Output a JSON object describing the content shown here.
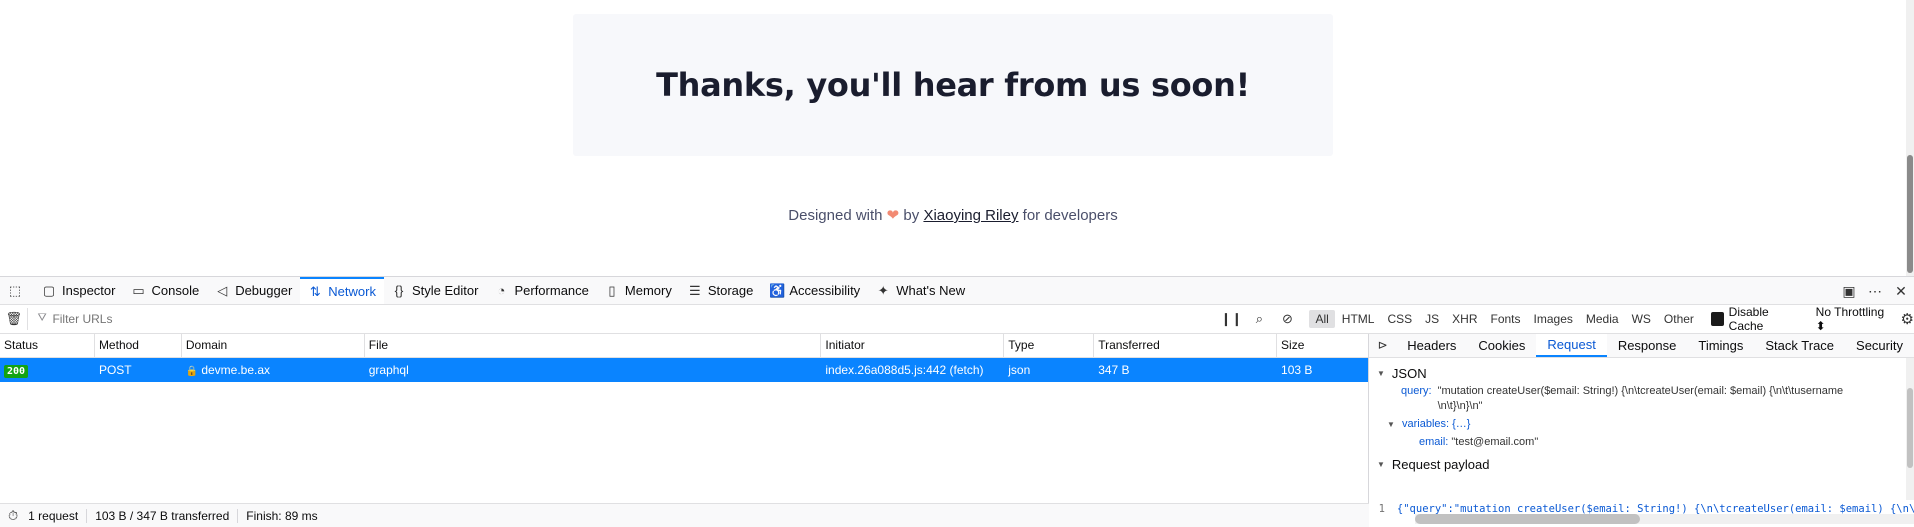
{
  "page": {
    "thanks_title": "Thanks, you'll hear from us soon!",
    "footer": {
      "prefix": "Designed with",
      "heart": "❤",
      "by": "by",
      "author": "Xiaoying Riley",
      "suffix": "for developers"
    }
  },
  "devtools": {
    "tabs": [
      {
        "label": "Inspector",
        "icon": "inspector-icon"
      },
      {
        "label": "Console",
        "icon": "console-icon"
      },
      {
        "label": "Debugger",
        "icon": "debugger-icon"
      },
      {
        "label": "Network",
        "icon": "network-icon",
        "active": true
      },
      {
        "label": "Style Editor",
        "icon": "style-editor-icon"
      },
      {
        "label": "Performance",
        "icon": "performance-icon"
      },
      {
        "label": "Memory",
        "icon": "memory-icon"
      },
      {
        "label": "Storage",
        "icon": "storage-icon"
      },
      {
        "label": "Accessibility",
        "icon": "accessibility-icon"
      },
      {
        "label": "What's New",
        "icon": "whats-new-icon"
      }
    ],
    "filter_placeholder": "Filter URLs",
    "type_filters": [
      "All",
      "HTML",
      "CSS",
      "JS",
      "XHR",
      "Fonts",
      "Images",
      "Media",
      "WS",
      "Other"
    ],
    "disable_cache": "Disable Cache",
    "throttling": "No Throttling ⬍",
    "columns": [
      "Status",
      "Method",
      "Domain",
      "File",
      "Initiator",
      "Type",
      "Transferred",
      "Size"
    ],
    "rows": [
      {
        "status": "200",
        "method": "POST",
        "domain": "devme.be.ax",
        "file": "graphql",
        "initiator": "index.26a088d5.js:442 (fetch)",
        "type": "json",
        "transferred": "347 B",
        "size": "103 B"
      }
    ],
    "summary": {
      "requests": "1 request",
      "transferred": "103 B / 347 B transferred",
      "finish": "Finish: 89 ms"
    },
    "side_tabs": [
      "Headers",
      "Cookies",
      "Request",
      "Response",
      "Timings",
      "Stack Trace",
      "Security"
    ],
    "side_active": "Request",
    "json_section": "JSON",
    "json": {
      "query_key": "query:",
      "query_val": "\"mutation createUser($email: String!) {\\n\\tcreateUser(email: $email) {\\n\\t\\tusername",
      "query_val2": "\\n\\t}\\n}\\n\"",
      "variables_key": "variables:",
      "variables_val": "{…}",
      "email_key": "email:",
      "email_val": "\"test@email.com\""
    },
    "payload_section": "Request payload",
    "payload_line_no": "1",
    "payload_code": "{\"query\":\"mutation createUser($email: String!) {\\n\\tcreateUser(email: $email) {\\n\\t\\tusername\\n\\t}\\n}\\n\",\"variables\":{\"email\":\"test@email.com\"}}"
  },
  "colors": {
    "accent": "#0a84ff",
    "status_ok": "#12a312",
    "heart": "#f28a73"
  }
}
